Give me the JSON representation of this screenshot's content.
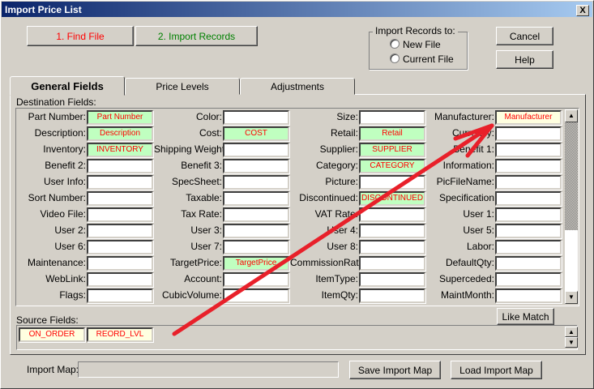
{
  "window": {
    "title": "Import Price List",
    "close": "X"
  },
  "toolbar": {
    "find_file": "1. Find File",
    "import_records": "2. Import Records",
    "cancel": "Cancel",
    "help": "Help",
    "colors": {
      "find": "#ff0000",
      "import": "#008000"
    }
  },
  "import_to": {
    "label": "Import Records to:",
    "options": [
      "New File",
      "Current File"
    ]
  },
  "tabs": [
    "General Fields",
    "Price Levels",
    "Adjustments"
  ],
  "destination": {
    "label": "Destination Fields:",
    "columns": [
      [
        {
          "label": "Part Number:",
          "value": "Part Number",
          "hl": "green"
        },
        {
          "label": "Description:",
          "value": "Description",
          "hl": "green"
        },
        {
          "label": "Inventory:",
          "value": "INVENTORY",
          "hl": "green"
        },
        {
          "label": "Benefit 2:"
        },
        {
          "label": "User Info:"
        },
        {
          "label": "Sort Number:"
        },
        {
          "label": "Video File:"
        },
        {
          "label": "User 2:"
        },
        {
          "label": "User 6:"
        },
        {
          "label": "Maintenance:"
        },
        {
          "label": "WebLink:"
        },
        {
          "label": "Flags:"
        }
      ],
      [
        {
          "label": "Color:"
        },
        {
          "label": "Cost:",
          "value": "COST",
          "hl": "green"
        },
        {
          "label": "Shipping Weight:"
        },
        {
          "label": "Benefit 3:"
        },
        {
          "label": "SpecSheet:"
        },
        {
          "label": "Taxable:"
        },
        {
          "label": "Tax Rate:"
        },
        {
          "label": "User 3:"
        },
        {
          "label": "User 7:"
        },
        {
          "label": "TargetPrice:",
          "value": "TargetPrice",
          "hl": "green"
        },
        {
          "label": "Account:"
        },
        {
          "label": "CubicVolume:"
        }
      ],
      [
        {
          "label": "Size:"
        },
        {
          "label": "Retail:",
          "value": "Retail",
          "hl": "green"
        },
        {
          "label": "Supplier:",
          "value": "SUPPLIER",
          "hl": "green"
        },
        {
          "label": "Category:",
          "value": "CATEGORY",
          "hl": "green"
        },
        {
          "label": "Picture:"
        },
        {
          "label": "Discontinued:",
          "value": "DISCONTINUED",
          "hl": "green"
        },
        {
          "label": "VAT Rate:"
        },
        {
          "label": "User 4:"
        },
        {
          "label": "User 8:"
        },
        {
          "label": "CommissionRate:"
        },
        {
          "label": "ItemType:"
        },
        {
          "label": "ItemQty:"
        }
      ],
      [
        {
          "label": "Manufacturer:",
          "value": "Manufacturer",
          "hl": "yellow"
        },
        {
          "label": "Currency:"
        },
        {
          "label": "Benefit 1:"
        },
        {
          "label": "Information:"
        },
        {
          "label": "PicFileName:"
        },
        {
          "label": "Specification"
        },
        {
          "label": "User 1:"
        },
        {
          "label": "User 5:"
        },
        {
          "label": "Labor:"
        },
        {
          "label": "DefaultQty:"
        },
        {
          "label": "Superceded:"
        },
        {
          "label": "MaintMonth:"
        }
      ]
    ]
  },
  "like_match": "Like Match",
  "source": {
    "label": "Source Fields:",
    "fields": [
      "ON_ORDER",
      "REORD_LVL"
    ]
  },
  "import_map": {
    "label": "Import Map:",
    "value": "",
    "save": "Save Import Map",
    "load": "Load Import Map"
  },
  "annotation": {
    "color": "#e8202a"
  }
}
